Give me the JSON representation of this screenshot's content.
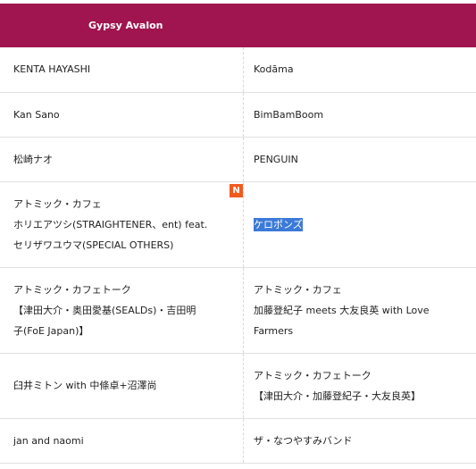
{
  "header": {
    "title": "Gypsy Avalon"
  },
  "rows": [
    {
      "left": [
        "KENTA HAYASHI"
      ],
      "right": [
        "Kodāma"
      ]
    },
    {
      "left": [
        "Kan Sano"
      ],
      "right": [
        "BimBamBoom"
      ]
    },
    {
      "left": [
        "松崎ナオ"
      ],
      "right": [
        "PENGUIN"
      ]
    },
    {
      "left": [
        "アトミック・カフェ",
        "ホリエアツシ(STRAIGHTENER、ent) feat.",
        "セリザワユウマ(SPECIAL OTHERS)"
      ],
      "left_badge": "N",
      "right": [
        "ケロポンズ"
      ],
      "right_selected": true
    },
    {
      "left": [
        "アトミック・カフェトーク",
        "【津田大介・奥田愛基(SEALDs)・吉田明",
        "子(FoE Japan)】"
      ],
      "right": [
        "アトミック・カフェ",
        "加藤登紀子 meets 大友良英 with Love",
        "Farmers"
      ]
    },
    {
      "left": [
        "臼井ミトン with 中條卓+沼澤尚"
      ],
      "right": [
        "アトミック・カフェトーク",
        "【津田大介・加藤登紀子・大友良英】"
      ]
    },
    {
      "left": [
        "jan and naomi"
      ],
      "right": [
        "ザ・なつやすみバンド"
      ]
    }
  ],
  "colors": {
    "header_bg": "#a0154f",
    "badge_bg": "#f25a1d",
    "selection_bg": "#3b7ad8"
  }
}
